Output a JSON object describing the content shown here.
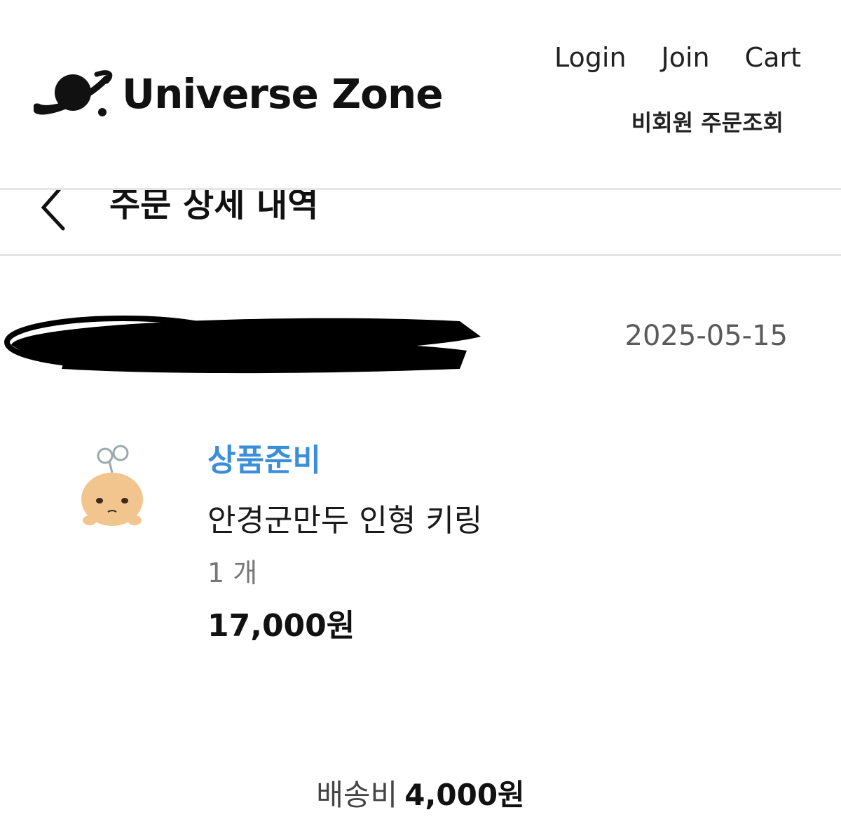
{
  "header": {
    "brand": "Universe Zone",
    "logo_icon": "planet-icon",
    "nav": {
      "login": "Login",
      "join": "Join",
      "cart": "Cart"
    },
    "guest_order_lookup": "비회원 주문조회"
  },
  "subheader": {
    "back_icon": "chevron-left-icon",
    "title": "주문 상세 내역"
  },
  "order": {
    "date": "2025-05-15"
  },
  "product": {
    "status": "상품준비",
    "name": "안경군만두 인형 키링",
    "quantity": "1 개",
    "price": "17,000원"
  },
  "shipping": {
    "label": "배송비",
    "value": "4,000원"
  },
  "colors": {
    "accent_blue": "#3b8fd9",
    "divider": "#e6e6e6",
    "date_gray": "#5a5a5a"
  }
}
